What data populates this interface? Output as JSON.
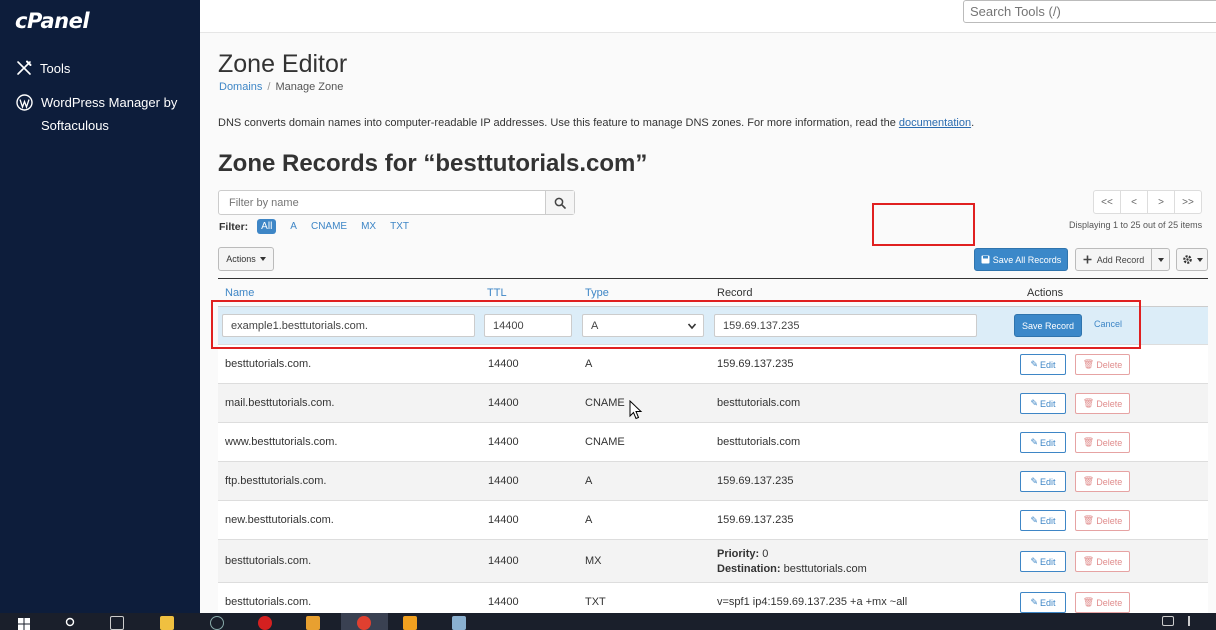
{
  "brand": {
    "logo": "cPanel"
  },
  "sidebar": {
    "items": [
      {
        "label": "Tools",
        "icon": "tools-icon"
      },
      {
        "label": "WordPress Manager by Softaculous",
        "icon": "wordpress-icon"
      }
    ]
  },
  "topbar": {
    "search_placeholder": "Search Tools (/)"
  },
  "page": {
    "title": "Zone Editor",
    "breadcrumb": {
      "link": "Domains",
      "current": "Manage Zone"
    },
    "description": "DNS converts domain names into computer-readable IP addresses. Use this feature to manage DNS zones. For more information, read the ",
    "doc_link": "documentation",
    "description_end": ".",
    "zone_title": "Zone Records for “besttutorials.com”"
  },
  "filter": {
    "placeholder": "Filter by name",
    "label": "Filter:",
    "chips": [
      "All",
      "A",
      "CNAME",
      "MX",
      "TXT"
    ],
    "active_chip": "All"
  },
  "pager": {
    "first": "<<",
    "prev": "<",
    "next": ">",
    "last": ">>",
    "info": "Displaying 1 to 25 out of 25 items"
  },
  "toolbar": {
    "actions": "Actions",
    "save_all": "Save All Records",
    "add_record": "Add Record"
  },
  "table": {
    "headers": {
      "name": "Name",
      "ttl": "TTL",
      "type": "Type",
      "record": "Record",
      "actions": "Actions"
    },
    "edit_row": {
      "name": "example1.besttutorials.com.",
      "ttl": "14400",
      "type": "A",
      "record": "159.69.137.235",
      "save": "Save Record",
      "cancel": "Cancel"
    },
    "edit_label": "Edit",
    "delete_label": "Delete",
    "rows": [
      {
        "name": "besttutorials.com.",
        "ttl": "14400",
        "type": "A",
        "record": "159.69.137.235"
      },
      {
        "name": "mail.besttutorials.com.",
        "ttl": "14400",
        "type": "CNAME",
        "record": "besttutorials.com"
      },
      {
        "name": "www.besttutorials.com.",
        "ttl": "14400",
        "type": "CNAME",
        "record": "besttutorials.com"
      },
      {
        "name": "ftp.besttutorials.com.",
        "ttl": "14400",
        "type": "A",
        "record": "159.69.137.235"
      },
      {
        "name": "new.besttutorials.com.",
        "ttl": "14400",
        "type": "A",
        "record": "159.69.137.235"
      },
      {
        "name": "besttutorials.com.",
        "ttl": "14400",
        "type": "MX",
        "priority_label": "Priority:",
        "priority": "0",
        "destination_label": "Destination:",
        "destination": "besttutorials.com"
      },
      {
        "name": "besttutorials.com.",
        "ttl": "14400",
        "type": "TXT",
        "record": "v=spf1 ip4:159.69.137.235 +a +mx ~all"
      }
    ]
  },
  "colors": {
    "sidebar": "#0d1d3b",
    "primary": "#3b88c9",
    "link": "#3e86c6",
    "danger": "#e08d8d",
    "highlight": "#e02020",
    "edit_row": "#dcedf8"
  }
}
